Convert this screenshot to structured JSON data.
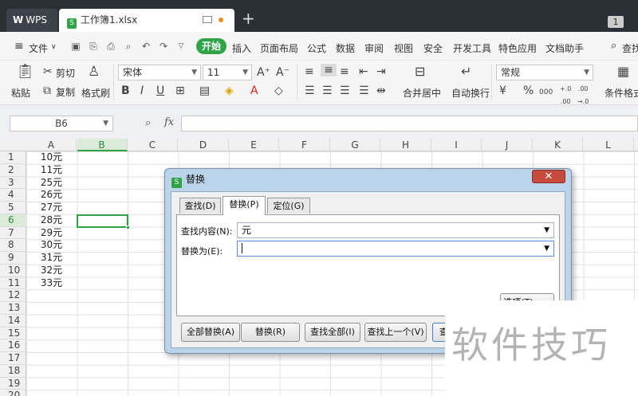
{
  "titlebar": {
    "app_tab": "WPS",
    "file_tab": "工作簿1.xlsx",
    "new_tab": "+",
    "window_badge": "1"
  },
  "menu": {
    "file": "文件",
    "start": "开始",
    "items": [
      "插入",
      "页面布局",
      "公式",
      "数据",
      "审阅",
      "视图",
      "安全",
      "开发工具",
      "特色应用",
      "文档助手"
    ],
    "search": "查找"
  },
  "ribbon": {
    "paste": "粘贴",
    "cut": "剪切",
    "copy": "复制",
    "format_painter": "格式刷",
    "font": "宋体",
    "font_size": "11",
    "merge": "合并居中",
    "wrap": "自动换行",
    "number_format": "常规",
    "cond_format": "条件格式",
    "percent": "%",
    "thousands": "000"
  },
  "formula_bar": {
    "name_box": "B6",
    "fx": "fx",
    "formula": ""
  },
  "sheet": {
    "columns": [
      "A",
      "B",
      "C",
      "D",
      "E",
      "F",
      "G",
      "H",
      "I",
      "J",
      "K",
      "L"
    ],
    "selected_column": "B",
    "rows": [
      "1",
      "2",
      "3",
      "4",
      "5",
      "6",
      "7",
      "8",
      "9",
      "10",
      "11",
      "12",
      "13",
      "14",
      "15",
      "16",
      "17",
      "18",
      "19",
      "20"
    ],
    "selected_row": "6",
    "column_a": [
      "10元",
      "11元",
      "25元",
      "26元",
      "27元",
      "28元",
      "29元",
      "30元",
      "31元",
      "32元",
      "33元"
    ]
  },
  "dialog": {
    "title": "替换",
    "tabs": [
      "查找(D)",
      "替换(P)",
      "定位(G)"
    ],
    "active_tab": "替换(P)",
    "find_label": "查找内容(N):",
    "find_value": "元",
    "replace_label": "替换为(E):",
    "replace_value": "",
    "options_button": "选项(T) >>",
    "buttons": [
      "全部替换(A)",
      "替换(R)",
      "查找全部(I)",
      "查找上一个(V)",
      "查找"
    ]
  },
  "watermark": "软件技巧"
}
